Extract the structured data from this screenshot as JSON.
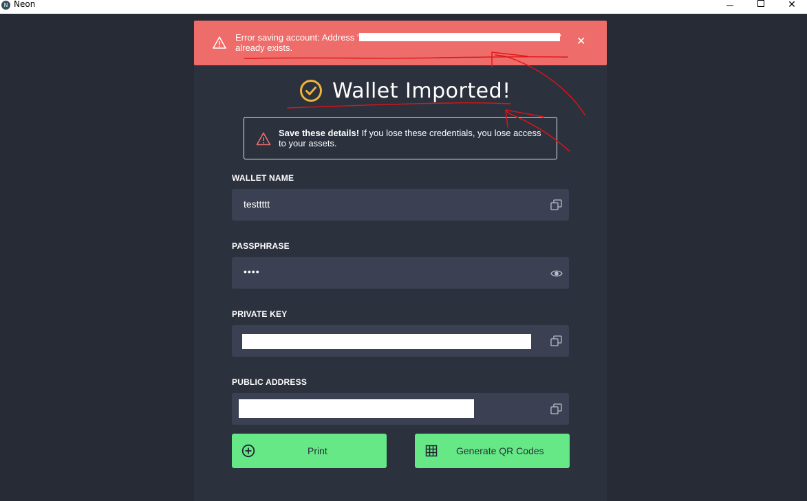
{
  "window": {
    "title": "Neon",
    "app_icon_letter": "N",
    "close_glyph": "✕"
  },
  "error_banner": {
    "text_before": "Error saving account: Address '",
    "text_after": "' already exists.",
    "close_glyph": "✕",
    "icon": "warning-icon"
  },
  "heading": {
    "title": "Wallet Imported!",
    "icon": "check-circle-icon",
    "accent_color": "#f0b33a"
  },
  "notice": {
    "bold": "Save these details!",
    "text": " If you lose these credentials, you lose access to your assets.",
    "icon": "warning-icon"
  },
  "fields": {
    "wallet_name": {
      "label": "WALLET NAME",
      "value": "testtttt",
      "icon": "copy-icon"
    },
    "passphrase": {
      "label": "PASSPHRASE",
      "value": "••••",
      "icon": "eye-icon"
    },
    "private_key": {
      "label": "PRIVATE KEY",
      "icon": "copy-icon"
    },
    "public_address": {
      "label": "PUBLIC ADDRESS",
      "icon": "copy-icon"
    }
  },
  "buttons": {
    "print": {
      "label": "Print",
      "icon": "plus-circle-icon"
    },
    "qr": {
      "label": "Generate QR Codes",
      "icon": "grid-icon"
    }
  },
  "colors": {
    "background": "#262b36",
    "panel": "#2c313e",
    "input": "#3b4152",
    "error": "#ee6d6a",
    "button": "#66e886",
    "annotation": "#e01414"
  }
}
